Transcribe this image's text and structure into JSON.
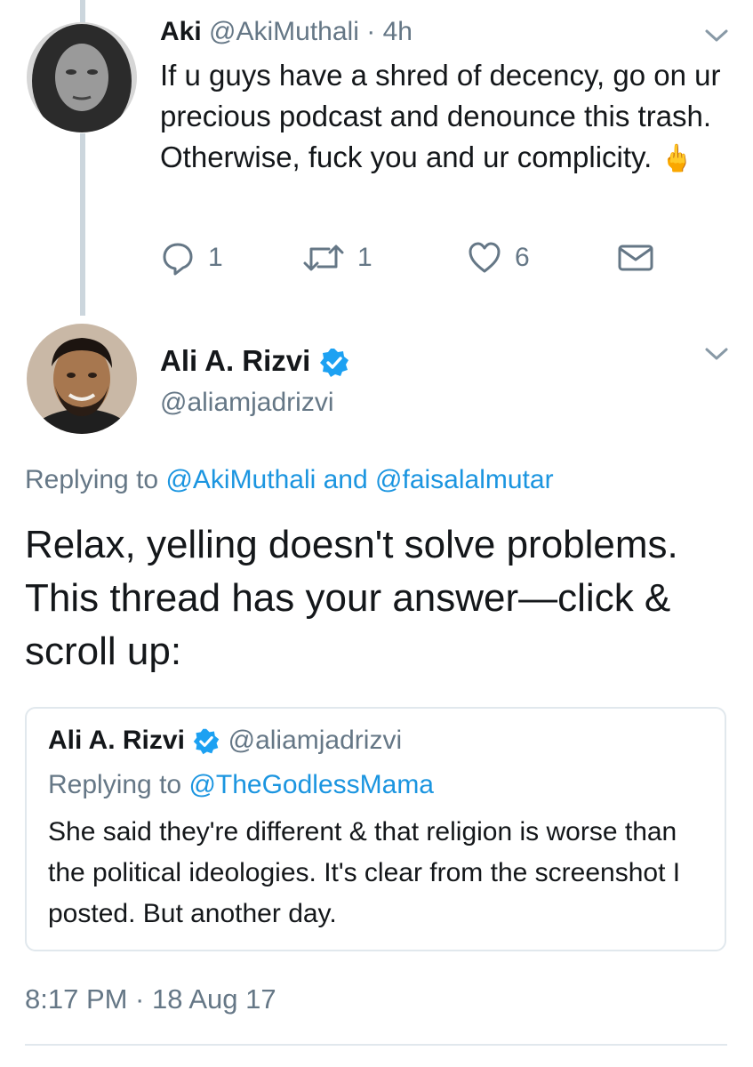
{
  "reply_tweet": {
    "display_name": "Aki",
    "handle": "@AkiMuthali",
    "separator": "·",
    "time_ago": "4h",
    "body": "If u guys have a shred of decency, go on ur precious podcast and denounce this trash. Otherwise, fuck you and ur complicity.",
    "emoji": "🖕",
    "actions": {
      "replies": "1",
      "retweets": "1",
      "likes": "6"
    }
  },
  "main_tweet": {
    "display_name": "Ali A. Rizvi",
    "handle": "@aliamjadrizvi",
    "replying_prefix": "Replying to",
    "replying_handle_1": "@AkiMuthali",
    "replying_and": "and",
    "replying_handle_2": "@faisalalmutar",
    "body": "Relax, yelling doesn't solve problems. This thread has your answer—click & scroll up:",
    "timestamp": "8:17 PM · 18 Aug 17"
  },
  "quoted_tweet": {
    "display_name": "Ali A. Rizvi",
    "handle": "@aliamjadrizvi",
    "replying_prefix": "Replying to",
    "replying_handle": "@TheGodlessMama",
    "body": "She said they're different & that religion is worse than the political ideologies. It's clear from the screenshot I posted. But another day."
  },
  "colors": {
    "link": "#1b95e0",
    "muted": "#657786",
    "text": "#14171a",
    "thread_line": "#ccd6dd",
    "border": "#e1e8ed"
  },
  "icons": [
    "chevron-down-icon",
    "reply-icon",
    "retweet-icon",
    "like-icon",
    "direct-message-icon",
    "verified-badge-icon"
  ]
}
